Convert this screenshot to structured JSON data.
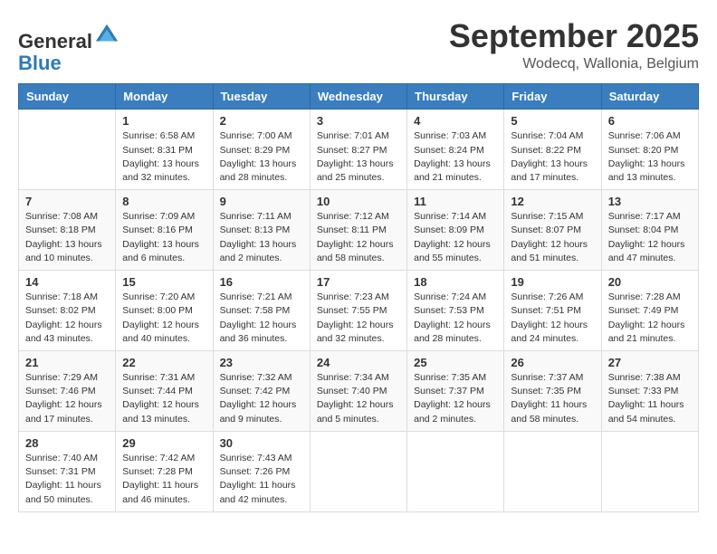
{
  "logo": {
    "general": "General",
    "blue": "Blue"
  },
  "header": {
    "month": "September 2025",
    "location": "Wodecq, Wallonia, Belgium"
  },
  "weekdays": [
    "Sunday",
    "Monday",
    "Tuesday",
    "Wednesday",
    "Thursday",
    "Friday",
    "Saturday"
  ],
  "weeks": [
    [
      {
        "day": null,
        "info": null
      },
      {
        "day": "1",
        "info": "Sunrise: 6:58 AM\nSunset: 8:31 PM\nDaylight: 13 hours\nand 32 minutes."
      },
      {
        "day": "2",
        "info": "Sunrise: 7:00 AM\nSunset: 8:29 PM\nDaylight: 13 hours\nand 28 minutes."
      },
      {
        "day": "3",
        "info": "Sunrise: 7:01 AM\nSunset: 8:27 PM\nDaylight: 13 hours\nand 25 minutes."
      },
      {
        "day": "4",
        "info": "Sunrise: 7:03 AM\nSunset: 8:24 PM\nDaylight: 13 hours\nand 21 minutes."
      },
      {
        "day": "5",
        "info": "Sunrise: 7:04 AM\nSunset: 8:22 PM\nDaylight: 13 hours\nand 17 minutes."
      },
      {
        "day": "6",
        "info": "Sunrise: 7:06 AM\nSunset: 8:20 PM\nDaylight: 13 hours\nand 13 minutes."
      }
    ],
    [
      {
        "day": "7",
        "info": "Sunrise: 7:08 AM\nSunset: 8:18 PM\nDaylight: 13 hours\nand 10 minutes."
      },
      {
        "day": "8",
        "info": "Sunrise: 7:09 AM\nSunset: 8:16 PM\nDaylight: 13 hours\nand 6 minutes."
      },
      {
        "day": "9",
        "info": "Sunrise: 7:11 AM\nSunset: 8:13 PM\nDaylight: 13 hours\nand 2 minutes."
      },
      {
        "day": "10",
        "info": "Sunrise: 7:12 AM\nSunset: 8:11 PM\nDaylight: 12 hours\nand 58 minutes."
      },
      {
        "day": "11",
        "info": "Sunrise: 7:14 AM\nSunset: 8:09 PM\nDaylight: 12 hours\nand 55 minutes."
      },
      {
        "day": "12",
        "info": "Sunrise: 7:15 AM\nSunset: 8:07 PM\nDaylight: 12 hours\nand 51 minutes."
      },
      {
        "day": "13",
        "info": "Sunrise: 7:17 AM\nSunset: 8:04 PM\nDaylight: 12 hours\nand 47 minutes."
      }
    ],
    [
      {
        "day": "14",
        "info": "Sunrise: 7:18 AM\nSunset: 8:02 PM\nDaylight: 12 hours\nand 43 minutes."
      },
      {
        "day": "15",
        "info": "Sunrise: 7:20 AM\nSunset: 8:00 PM\nDaylight: 12 hours\nand 40 minutes."
      },
      {
        "day": "16",
        "info": "Sunrise: 7:21 AM\nSunset: 7:58 PM\nDaylight: 12 hours\nand 36 minutes."
      },
      {
        "day": "17",
        "info": "Sunrise: 7:23 AM\nSunset: 7:55 PM\nDaylight: 12 hours\nand 32 minutes."
      },
      {
        "day": "18",
        "info": "Sunrise: 7:24 AM\nSunset: 7:53 PM\nDaylight: 12 hours\nand 28 minutes."
      },
      {
        "day": "19",
        "info": "Sunrise: 7:26 AM\nSunset: 7:51 PM\nDaylight: 12 hours\nand 24 minutes."
      },
      {
        "day": "20",
        "info": "Sunrise: 7:28 AM\nSunset: 7:49 PM\nDaylight: 12 hours\nand 21 minutes."
      }
    ],
    [
      {
        "day": "21",
        "info": "Sunrise: 7:29 AM\nSunset: 7:46 PM\nDaylight: 12 hours\nand 17 minutes."
      },
      {
        "day": "22",
        "info": "Sunrise: 7:31 AM\nSunset: 7:44 PM\nDaylight: 12 hours\nand 13 minutes."
      },
      {
        "day": "23",
        "info": "Sunrise: 7:32 AM\nSunset: 7:42 PM\nDaylight: 12 hours\nand 9 minutes."
      },
      {
        "day": "24",
        "info": "Sunrise: 7:34 AM\nSunset: 7:40 PM\nDaylight: 12 hours\nand 5 minutes."
      },
      {
        "day": "25",
        "info": "Sunrise: 7:35 AM\nSunset: 7:37 PM\nDaylight: 12 hours\nand 2 minutes."
      },
      {
        "day": "26",
        "info": "Sunrise: 7:37 AM\nSunset: 7:35 PM\nDaylight: 11 hours\nand 58 minutes."
      },
      {
        "day": "27",
        "info": "Sunrise: 7:38 AM\nSunset: 7:33 PM\nDaylight: 11 hours\nand 54 minutes."
      }
    ],
    [
      {
        "day": "28",
        "info": "Sunrise: 7:40 AM\nSunset: 7:31 PM\nDaylight: 11 hours\nand 50 minutes."
      },
      {
        "day": "29",
        "info": "Sunrise: 7:42 AM\nSunset: 7:28 PM\nDaylight: 11 hours\nand 46 minutes."
      },
      {
        "day": "30",
        "info": "Sunrise: 7:43 AM\nSunset: 7:26 PM\nDaylight: 11 hours\nand 42 minutes."
      },
      {
        "day": null,
        "info": null
      },
      {
        "day": null,
        "info": null
      },
      {
        "day": null,
        "info": null
      },
      {
        "day": null,
        "info": null
      }
    ]
  ]
}
